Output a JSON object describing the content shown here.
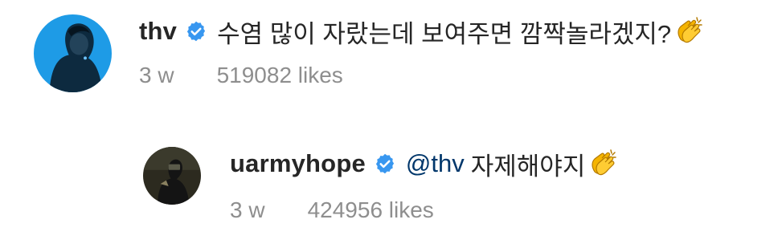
{
  "comments": [
    {
      "username": "thv",
      "text": "수염 많이 자랐는데 보여주면 깜짝놀라겠지?",
      "emoji_icon": "clapping-hands-icon",
      "time": "3 w",
      "likes": "519082 likes",
      "avatar_bg": "#1e9be6"
    },
    {
      "username": "uarmyhope",
      "mention": "@thv",
      "text": "자제해야지",
      "emoji_icon": "clapping-hands-icon",
      "time": "3 w",
      "likes": "424956 likes",
      "avatar_bg": "#2c2a1f"
    }
  ],
  "colors": {
    "verified_badge": "#3897f0",
    "mention": "#00376b",
    "meta_text": "#8e8e8e"
  }
}
